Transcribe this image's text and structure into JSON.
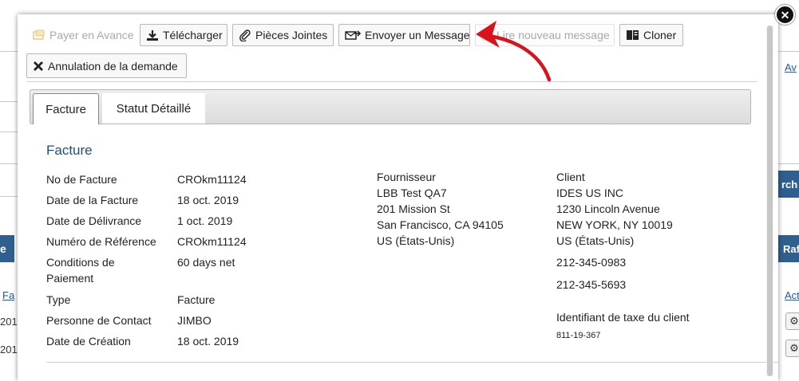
{
  "background": {
    "avail_text": "Av",
    "search_text": "rch",
    "left_button_text": "e",
    "right_button_text": "Raf",
    "left_link_text": "Fa",
    "right_link_text": "Act",
    "row1_left": "201",
    "row2_left": "201"
  },
  "toolbar": {
    "pay_in_advance": "Payer en Avance",
    "download": "Télécharger",
    "attachments": "Pièces Jointes",
    "send_message": "Envoyer un Message",
    "read_new_message": "Lire nouveau message",
    "clone": "Cloner",
    "cancel_request": "Annulation de la demande"
  },
  "tabs": [
    {
      "label": "Facture",
      "active": true
    },
    {
      "label": "Statut Détaillé",
      "active": false
    }
  ],
  "invoice": {
    "section_title": "Facture",
    "fields": [
      {
        "label": "No de Facture",
        "value": "CROkm11124"
      },
      {
        "label": "Date de la Facture",
        "value": "18 oct. 2019"
      },
      {
        "label": "Date de Délivrance",
        "value": "1 oct. 2019"
      },
      {
        "label": "Numéro de Référence",
        "value": "CROkm11124"
      },
      {
        "label": "Conditions de Paiement",
        "value": "60 days net"
      },
      {
        "label": "Type",
        "value": "Facture"
      },
      {
        "label": "Personne de Contact",
        "value": "JIMBO"
      },
      {
        "label": "Date de Création",
        "value": "18 oct. 2019"
      }
    ]
  },
  "supplier": {
    "heading": "Fournisseur",
    "lines": [
      "LBB Test QA7",
      "201 Mission St",
      "San Francisco, CA 94105",
      "US (États-Unis)"
    ]
  },
  "client": {
    "heading": "Client",
    "lines": [
      "IDES US INC",
      "1230 Lincoln Avenue",
      "NEW YORK, NY 10019",
      "US (États-Unis)"
    ],
    "phone1": "212-345-0983",
    "phone2": "212-345-5693",
    "tax_label": "Identifiant de taxe du client",
    "tax_value": "811-19-367"
  },
  "colors": {
    "accent_blue": "#1f4e79",
    "arrow_red": "#d9121b",
    "bg_blue": "#2f5f8f"
  }
}
